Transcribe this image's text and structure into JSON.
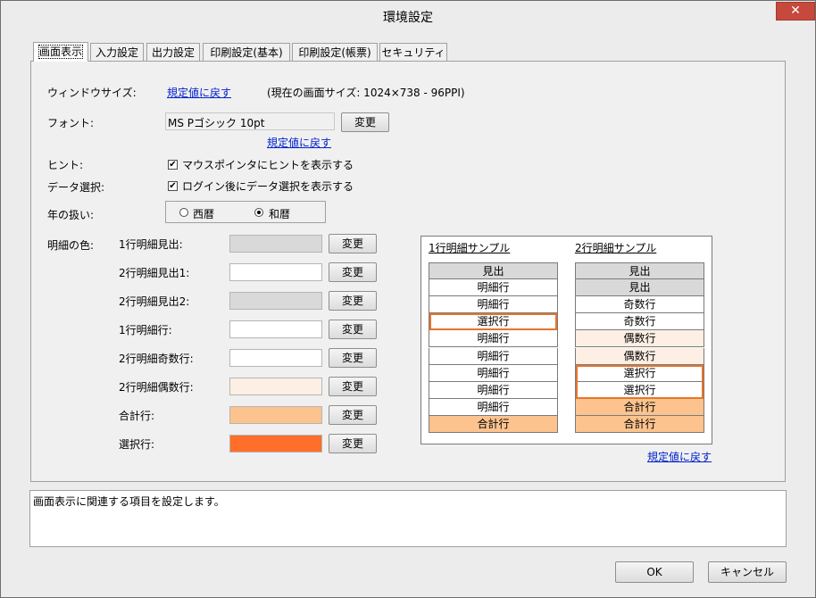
{
  "window": {
    "title": "環境設定",
    "close_label": "✕"
  },
  "tabs": [
    {
      "label": "画面表示",
      "active": true
    },
    {
      "label": "入力設定"
    },
    {
      "label": "出力設定"
    },
    {
      "label": "印刷設定(基本)"
    },
    {
      "label": "印刷設定(帳票)"
    },
    {
      "label": "セキュリティ"
    }
  ],
  "display": {
    "window_size": {
      "label": "ウィンドウサイズ:",
      "reset_link": "規定値に戻す",
      "current_info": "(現在の画面サイズ: 1024×738 - 96PPI)"
    },
    "font": {
      "label": "フォント:",
      "value": "MS Pゴシック 10pt",
      "change_button": "変更",
      "reset_link": "規定値に戻す"
    },
    "hint": {
      "label": "ヒント:",
      "checkbox_label": "マウスポインタにヒントを表示する",
      "checked": true
    },
    "data_select": {
      "label": "データ選択:",
      "checkbox_label": "ログイン後にデータ選択を表示する",
      "checked": true
    },
    "year": {
      "label": "年の扱い:",
      "options": [
        {
          "label": "西暦",
          "selected": false
        },
        {
          "label": "和暦",
          "selected": true
        }
      ]
    },
    "detail_colors": {
      "label": "明細の色:",
      "change_button": "変更",
      "rows": [
        {
          "label": "1行明細見出:",
          "color": "#d9d9d9"
        },
        {
          "label": "2行明細見出1:",
          "color": "#ffffff"
        },
        {
          "label": "2行明細見出2:",
          "color": "#d9d9d9"
        },
        {
          "label": "1行明細行:",
          "color": "#ffffff"
        },
        {
          "label": "2行明細奇数行:",
          "color": "#ffffff"
        },
        {
          "label": "2行明細偶数行:",
          "color": "#fdefe3"
        },
        {
          "label": "合計行:",
          "color": "#fcc38e"
        },
        {
          "label": "選択行:",
          "color": "#ff6f2a"
        }
      ]
    },
    "samples": {
      "one_line": {
        "title": "1行明細サンプル",
        "rows": [
          {
            "text": "見出",
            "kind": "header"
          },
          {
            "text": "明細行",
            "kind": "detail"
          },
          {
            "text": "明細行",
            "kind": "detail"
          },
          {
            "text": "選択行",
            "kind": "selected"
          },
          {
            "text": "明細行",
            "kind": "detail"
          },
          {
            "text": "明細行",
            "kind": "detail"
          },
          {
            "text": "明細行",
            "kind": "detail"
          },
          {
            "text": "明細行",
            "kind": "detail"
          },
          {
            "text": "明細行",
            "kind": "detail"
          },
          {
            "text": "合計行",
            "kind": "total"
          }
        ]
      },
      "two_line": {
        "title": "2行明細サンプル",
        "rows": [
          {
            "text": "見出",
            "kind": "header1"
          },
          {
            "text": "見出",
            "kind": "header2"
          },
          {
            "text": "奇数行",
            "kind": "odd"
          },
          {
            "text": "奇数行",
            "kind": "odd"
          },
          {
            "text": "偶数行",
            "kind": "even"
          },
          {
            "text": "偶数行",
            "kind": "even"
          },
          {
            "text": "選択行",
            "kind": "selected"
          },
          {
            "text": "選択行",
            "kind": "selected"
          },
          {
            "text": "合計行",
            "kind": "total"
          },
          {
            "text": "合計行",
            "kind": "total"
          }
        ]
      },
      "reset_link": "規定値に戻す"
    }
  },
  "description": "画面表示に関連する項目を設定します。",
  "buttons": {
    "ok": "OK",
    "cancel": "キャンセル"
  },
  "colors": {
    "selected_border": "#e8742a",
    "header_gray": "#d9d9d9",
    "total_orange": "#fcc38e",
    "even_row": "#fdefe3",
    "link_blue": "#0022cc"
  }
}
